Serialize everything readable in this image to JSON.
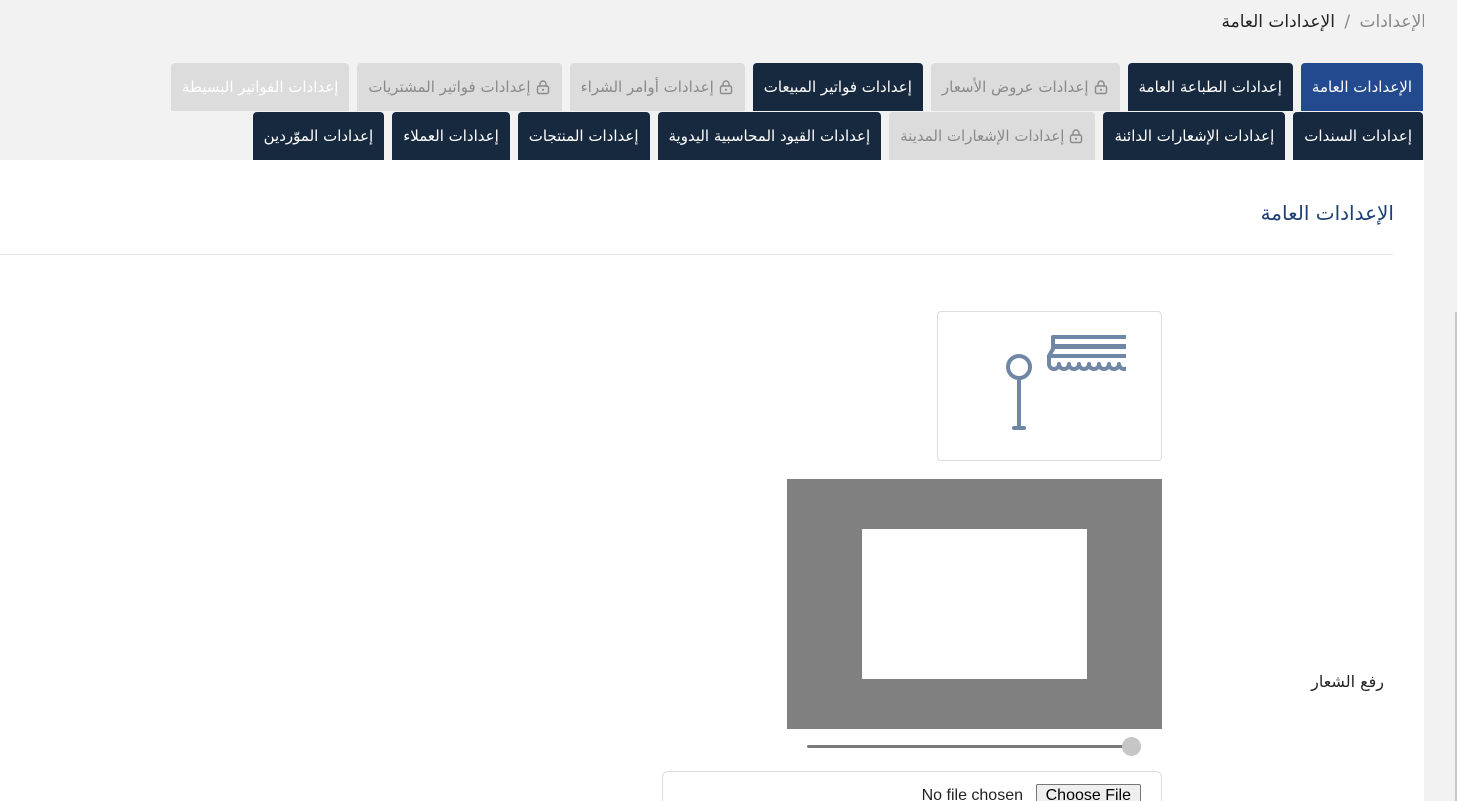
{
  "breadcrumb": {
    "parent": "الإعدادات",
    "separator": "/",
    "current": "الإعدادات العامة"
  },
  "tabs_row1": [
    {
      "label": "الإعدادات العامة",
      "state": "active"
    },
    {
      "label": "إعدادات الطباعة العامة",
      "state": "dark"
    },
    {
      "label": "إعدادات عروض الأسعار",
      "state": "locked",
      "icon": "lock-icon"
    },
    {
      "label": "إعدادات فواتير المبيعات",
      "state": "dark"
    },
    {
      "label": "إعدادات أوامر الشراء",
      "state": "locked",
      "icon": "lock-icon"
    },
    {
      "label": "إعدادات فواتير المشتريات",
      "state": "locked",
      "icon": "lock-icon"
    },
    {
      "label": "إعدادات الفواتير البسيطة",
      "state": "light"
    }
  ],
  "tabs_row2": [
    {
      "label": "إعدادات السندات",
      "state": "dark"
    },
    {
      "label": "إعدادات الإشعارات الدائنة",
      "state": "dark"
    },
    {
      "label": "إعدادات الإشعارات المدينة",
      "state": "locked",
      "icon": "lock-icon"
    },
    {
      "label": "إعدادات القيود المحاسبية اليدوية",
      "state": "dark"
    },
    {
      "label": "إعدادات المنتجات",
      "state": "dark"
    },
    {
      "label": "إعدادات العملاء",
      "state": "dark"
    },
    {
      "label": "إعدادات الموّردين",
      "state": "dark"
    }
  ],
  "section": {
    "title": "الإعدادات العامة"
  },
  "logo": {
    "label": "رفع الشعار",
    "placeholder_icon": "store-icon",
    "zoom_value": 1.0
  },
  "file_input": {
    "button_label": "Choose File",
    "status": "No file chosen"
  },
  "colors": {
    "active_tab": "#234a8e",
    "dark_tab": "#17293f",
    "locked_tab": "#dcdcdc",
    "title": "#1e3f73",
    "icon_stroke": "#6f87a4"
  }
}
